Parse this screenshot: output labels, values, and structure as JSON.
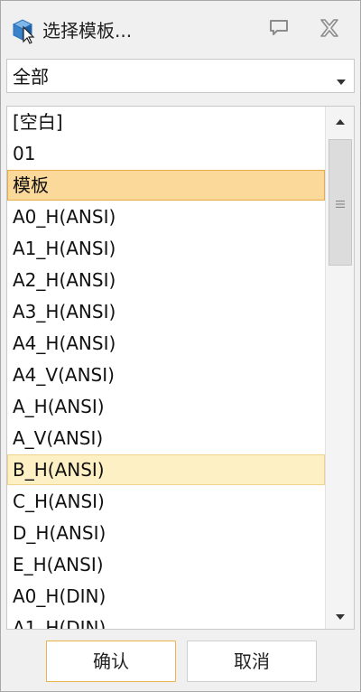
{
  "window": {
    "title": "选择模板..."
  },
  "filter": {
    "selected": "全部"
  },
  "list": {
    "items": [
      {
        "label": "[空白]",
        "state": "normal"
      },
      {
        "label": "01",
        "state": "normal"
      },
      {
        "label": "模板",
        "state": "selected"
      },
      {
        "label": "A0_H(ANSI)",
        "state": "normal"
      },
      {
        "label": "A1_H(ANSI)",
        "state": "normal"
      },
      {
        "label": "A2_H(ANSI)",
        "state": "normal"
      },
      {
        "label": "A3_H(ANSI)",
        "state": "normal"
      },
      {
        "label": "A4_H(ANSI)",
        "state": "normal"
      },
      {
        "label": "A4_V(ANSI)",
        "state": "normal"
      },
      {
        "label": "A_H(ANSI)",
        "state": "normal"
      },
      {
        "label": "A_V(ANSI)",
        "state": "normal"
      },
      {
        "label": "B_H(ANSI)",
        "state": "hover"
      },
      {
        "label": "C_H(ANSI)",
        "state": "normal"
      },
      {
        "label": "D_H(ANSI)",
        "state": "normal"
      },
      {
        "label": "E_H(ANSI)",
        "state": "normal"
      },
      {
        "label": "A0_H(DIN)",
        "state": "normal"
      },
      {
        "label": "A1_H(DIN)",
        "state": "normal"
      }
    ]
  },
  "buttons": {
    "ok": "确认",
    "cancel": "取消"
  },
  "colors": {
    "selected_bg": "#fbd99b",
    "selected_border": "#e8a94a",
    "hover_bg": "#fdf0c4",
    "ok_border": "#f0b24d"
  },
  "icons": {
    "app": "cube-cursor-icon",
    "help": "speech-bubble-icon",
    "close": "close-icon",
    "dropdown": "chevron-down-icon",
    "scroll_up": "arrow-up-icon",
    "scroll_down": "arrow-down-icon",
    "thumb_grip": "grip-lines-icon"
  }
}
